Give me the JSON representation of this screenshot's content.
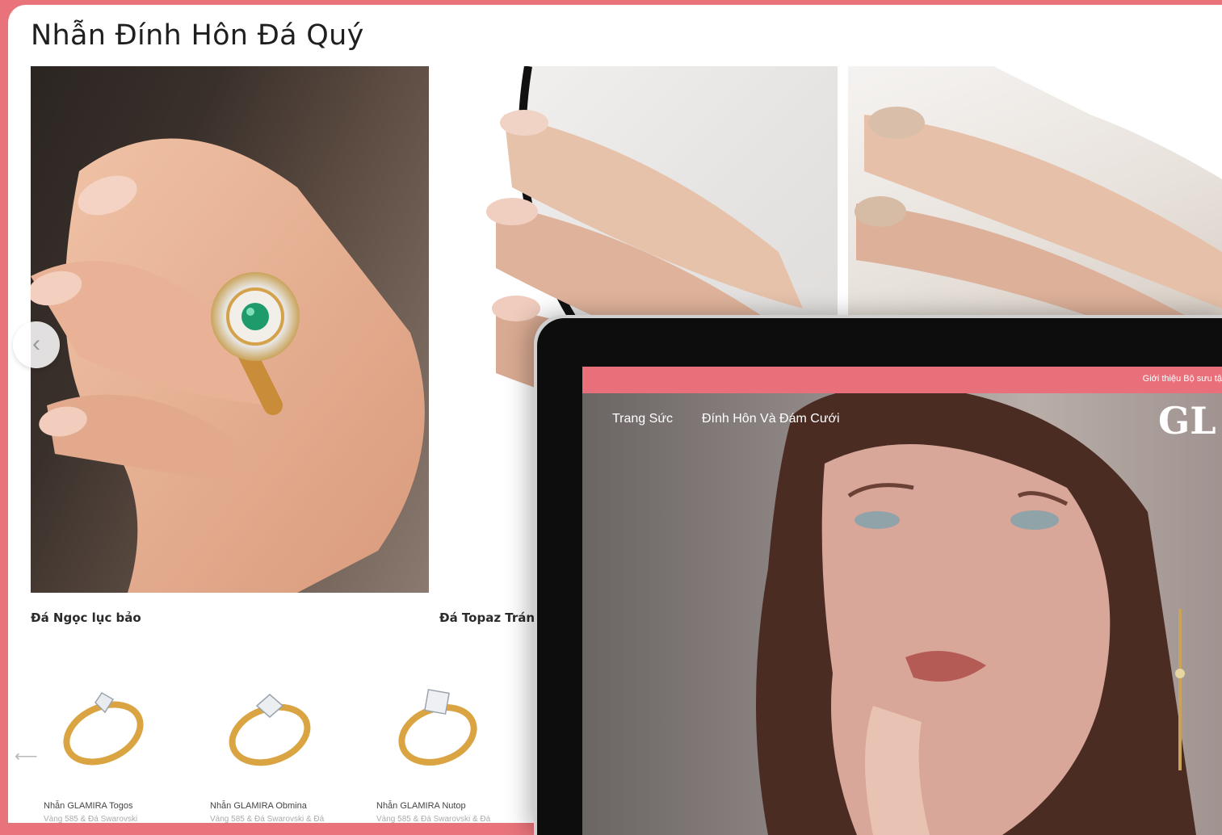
{
  "section": {
    "title": "Nhẫn Đính Hôn Đá Quý"
  },
  "tiles": [
    {
      "caption": "Đá Ngọc lục bảo"
    },
    {
      "caption": "Đá Topaz Tráng"
    }
  ],
  "products": [
    {
      "name": "Nhẫn GLAMIRA Togos",
      "sub": "Vàng 585 & Đá Swarovski"
    },
    {
      "name": "Nhẫn GLAMIRA Obmina",
      "sub": "Vàng 585 & Đá Swarovski & Đá"
    },
    {
      "name": "Nhẫn GLAMIRA Nutop",
      "sub": "Vàng 585 & Đá Swarovski & Đá"
    }
  ],
  "laptop": {
    "topbar_text": "Giới thiệu Bộ sưu tậ",
    "nav": [
      "Trang Sức",
      "Đính Hôn Và Đám Cưới"
    ],
    "logo": "GL"
  },
  "icons": {
    "prev": "chevron-left-icon",
    "bottom_prev": "arrow-left-icon"
  },
  "colors": {
    "accent": "#e8737b",
    "emerald": "#1e9b6a",
    "gold": "#d9a441"
  }
}
